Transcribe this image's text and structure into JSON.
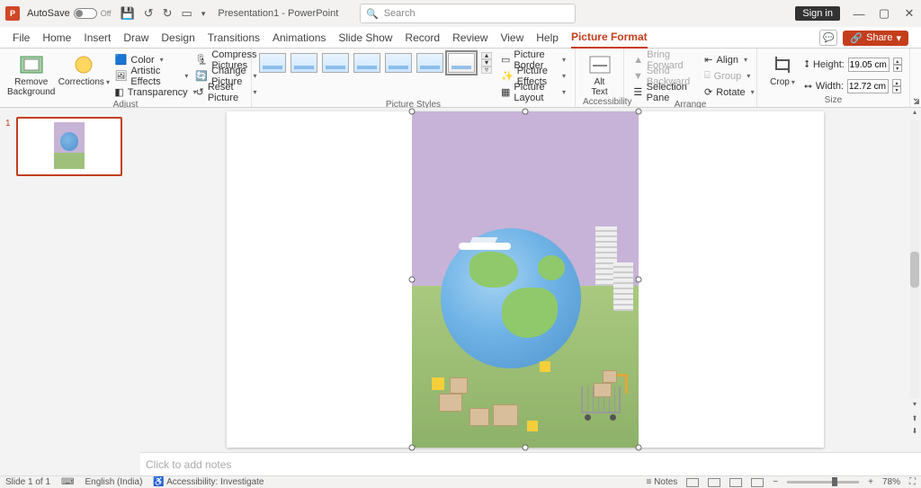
{
  "titlebar": {
    "autosave_label": "AutoSave",
    "autosave_state": "Off",
    "doc_title": "Presentation1 - PowerPoint",
    "search_placeholder": "Search",
    "signin": "Sign in"
  },
  "tabs": {
    "items": [
      "File",
      "Home",
      "Insert",
      "Draw",
      "Design",
      "Transitions",
      "Animations",
      "Slide Show",
      "Record",
      "Review",
      "View",
      "Help",
      "Picture Format"
    ],
    "active": "Picture Format",
    "share": "Share"
  },
  "ribbon": {
    "adjust": {
      "label": "Adjust",
      "remove_bg": "Remove\nBackground",
      "corrections": "Corrections",
      "color": "Color",
      "artistic": "Artistic Effects",
      "transparency": "Transparency",
      "compress": "Compress Pictures",
      "change": "Change Picture",
      "reset": "Reset Picture"
    },
    "styles": {
      "label": "Picture Styles",
      "border": "Picture Border",
      "effects": "Picture Effects",
      "layout": "Picture Layout"
    },
    "acc": {
      "label": "Accessibility",
      "alt": "Alt\nText"
    },
    "arrange": {
      "label": "Arrange",
      "bring_forward": "Bring Forward",
      "send_backward": "Send Backward",
      "selection_pane": "Selection Pane",
      "align": "Align",
      "group": "Group",
      "rotate": "Rotate"
    },
    "size": {
      "label": "Size",
      "crop": "Crop",
      "height_label": "Height:",
      "height_value": "19.05 cm",
      "width_label": "Width:",
      "width_value": "12.72 cm"
    }
  },
  "thumbs": {
    "num": "1"
  },
  "notes_placeholder": "Click to add notes",
  "statusbar": {
    "slide": "Slide 1 of 1",
    "lang": "English (India)",
    "acc": "Accessibility: Investigate",
    "notes_btn": "Notes",
    "zoom": "78%"
  }
}
